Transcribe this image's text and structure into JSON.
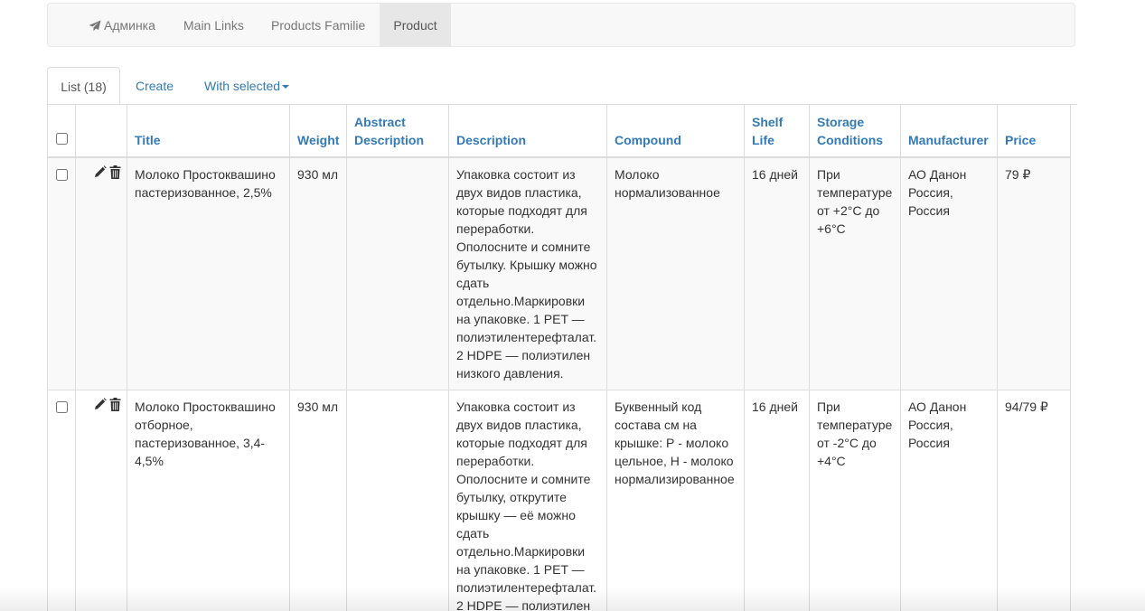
{
  "navbar": {
    "brand": "Админка",
    "brand_icon": "paper-plane-icon",
    "items": [
      "Main Links",
      "Products Familie",
      "Product"
    ],
    "active": "Product"
  },
  "tabs": {
    "list": "List (18)",
    "create": "Create",
    "with_selected": "With selected"
  },
  "table": {
    "columns": [
      "Title",
      "Weight",
      "Abstract Description",
      "Description",
      "Compound",
      "Shelf Life",
      "Storage Conditions",
      "Manufacturer",
      "Price"
    ],
    "rows": [
      {
        "title": "Молоко Простоквашино пастеризованное, 2,5%",
        "weight": "930 мл",
        "abstract": "",
        "description": "Упаковка состоит из двух видов пластика, которые подходят для переработки. Ополосните и сомните бутылку. Крышку можно сдать отдельно.Маркировки на упаковке. 1 PET — полиэтилентерефталат. 2 HDPE — полиэтилен низкого давления.",
        "compound": "Молоко нормализованное",
        "shelf_life": "16 дней",
        "storage": "При температуре от +2°C до +6°C",
        "manufacturer": "АО Данон Россия, Россия",
        "price": "79 ₽"
      },
      {
        "title": "Молоко Простоквашино отборное, пастеризованное, 3,4-4,5%",
        "weight": "930 мл",
        "abstract": "",
        "description": "Упаковка состоит из двух видов пластика, которые подходят для переработки. Ополосните и сомните бутылку, открутите крышку — её можно сдать отдельно.Маркировки на упаковке. 1 PET — полиэтилентерефталат. 2 HDPE — полиэтилен",
        "compound": "Буквенный код состава см на крышке: Р - молоко цельное, Н - молоко нормализированное",
        "shelf_life": "16 дней",
        "storage": "При температуре от -2°C до +4°C",
        "manufacturer": "АО Данон Россия, Россия",
        "price": "94/79 ₽"
      }
    ]
  },
  "colors": {
    "link": "#337ab7",
    "navbar_bg": "#f8f8f8",
    "active_nav_bg": "#e7e7e7",
    "border": "#dddddd",
    "row_stripe": "#f9f9f9"
  }
}
